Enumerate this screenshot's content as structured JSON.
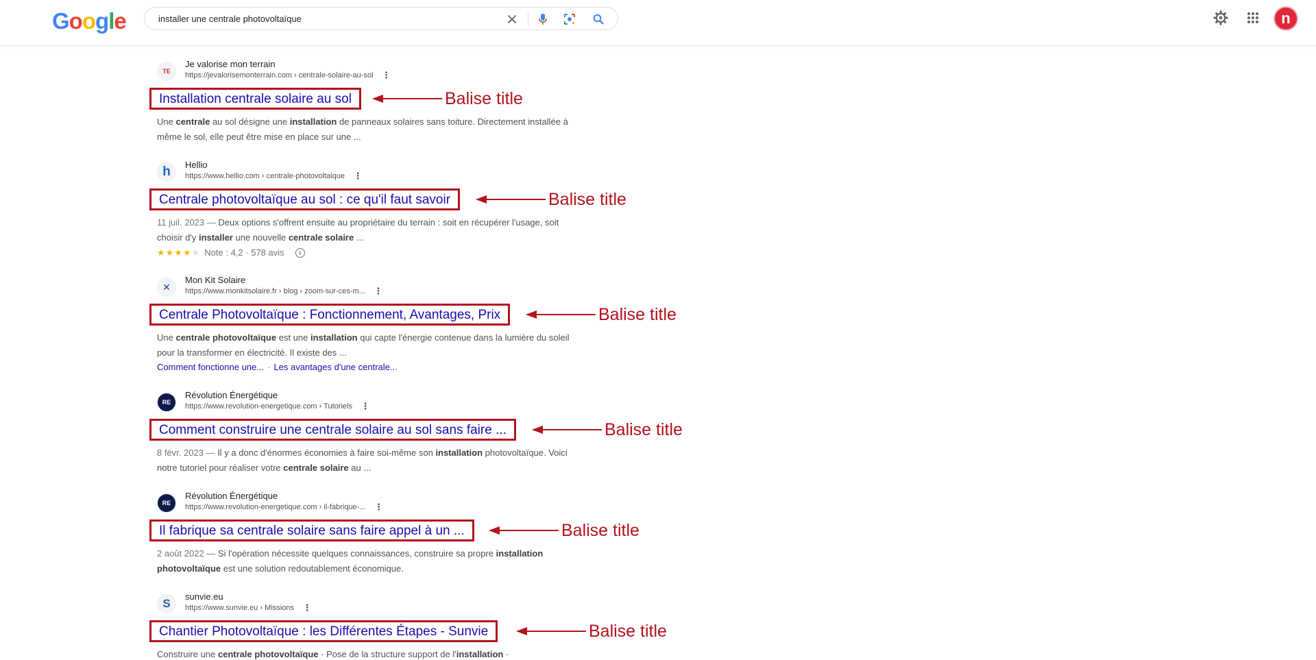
{
  "header": {
    "logo": {
      "letters": [
        "G",
        "o",
        "o",
        "g",
        "l",
        "e"
      ],
      "colors": [
        "#4285f4",
        "#ea4335",
        "#fbbc05",
        "#4285f4",
        "#34a853",
        "#ea4335"
      ]
    },
    "search_query": "installer une centrale photovoltaïque",
    "icons": {
      "clear": "close-icon",
      "voice": "microphone-icon",
      "lens": "lens-icon",
      "search": "search-icon",
      "settings": "gear-icon",
      "apps": "apps-grid-icon"
    },
    "avatar_letter": "n",
    "avatar_color": "#e0283a"
  },
  "annotation": {
    "label": "Balise title",
    "color": "#b3121e"
  },
  "results": [
    {
      "favicon": "TE",
      "site_name": "Je valorise mon terrain",
      "url": "https://jevalorisemonterrain.com › centrale-solaire-au-sol",
      "title": "Installation centrale solaire au sol",
      "snippet": {
        "date": "",
        "parts": [
          "Une ",
          "centrale",
          " au sol désigne une ",
          "installation",
          " de panneaux solaires sans toiture. Directement installée à même le sol, elle peut être mise en place sur une ..."
        ]
      }
    },
    {
      "favicon": "h",
      "site_name": "Hellio",
      "url": "https://www.hellio.com › centrale-photovoltaique",
      "title": "Centrale photovoltaïque au sol : ce qu'il faut savoir",
      "snippet": {
        "date": "11 juil. 2023",
        "parts": [
          "Deux options s'offrent ensuite au propriétaire du terrain : soit en récupérer l'usage, soit choisir d'y ",
          "installer",
          " une nouvelle ",
          "centrale solaire",
          " ..."
        ]
      },
      "rating": {
        "stars": 4,
        "text": "Note : 4,2 · 578 avis"
      }
    },
    {
      "favicon": "✕",
      "site_name": "Mon Kit Solaire",
      "url": "https://www.monkitsolaire.fr › blog › zoom-sur-ces-m...",
      "title": "Centrale Photovoltaïque : Fonctionnement, Avantages, Prix",
      "snippet": {
        "date": "",
        "parts": [
          "Une ",
          "centrale photovoltaïque",
          " est une ",
          "installation",
          " qui capte l'énergie contenue dans la lumière du soleil pour la transformer en électricité. Il existe des ..."
        ]
      },
      "sitelinks": [
        "Comment fonctionne une...",
        "Les avantages d'une centrale..."
      ]
    },
    {
      "favicon": "RE",
      "site_name": "Révolution Énergétique",
      "url": "https://www.revolution-energetique.com › Tutoriels",
      "title": "Comment construire une centrale solaire au sol sans faire ...",
      "snippet": {
        "date": "8 févr. 2023",
        "parts": [
          "Il y a donc d'énormes économies à faire soi-même son ",
          "installation",
          " photovoltaïque. Voici notre tutoriel pour réaliser votre ",
          "centrale solaire",
          " au ..."
        ]
      }
    },
    {
      "favicon": "RE",
      "site_name": "Révolution Énergétique",
      "url": "https://www.revolution-energetique.com › il-fabrique-...",
      "title": "Il fabrique sa centrale solaire sans faire appel à un ...",
      "snippet": {
        "date": "2 août 2022",
        "parts": [
          "Si l'opération nécessite quelques connaissances, construire sa propre ",
          "installation photovoltaïque",
          " est une solution redoutablement économique."
        ]
      }
    },
    {
      "favicon": "S",
      "site_name": "sunvie.eu",
      "url": "https://www.sunvie.eu › Missions",
      "title": "Chantier Photovoltaïque : les Différentes Étapes - Sunvie",
      "snippet": {
        "date": "",
        "parts": [
          "Construire une ",
          "centrale photovoltaïque",
          " · Pose de la structure support de l'",
          "installation",
          " ·"
        ]
      }
    }
  ]
}
